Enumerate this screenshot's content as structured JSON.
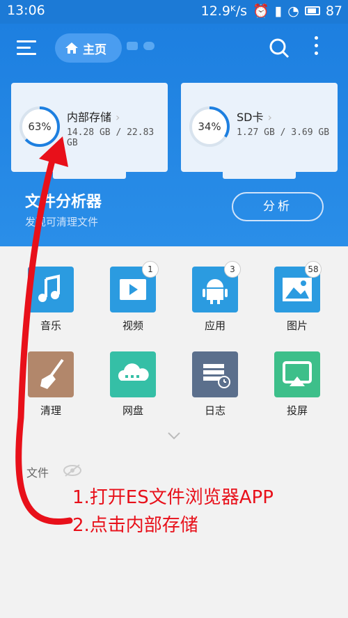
{
  "status_bar": {
    "time": "13:06",
    "speed": "12.9ᴷ/s",
    "battery": "87"
  },
  "header": {
    "home_label": "主页"
  },
  "storage": [
    {
      "name": "内部存储",
      "percent_label": "63%",
      "used_fraction": 0.63,
      "size": "14.28 GB / 22.83 GB"
    },
    {
      "name": "SD卡",
      "percent_label": "34%",
      "used_fraction": 0.34,
      "size": "1.27 GB / 3.69 GB"
    }
  ],
  "analyzer": {
    "title": "文件分析器",
    "subtitle": "发现可清理文件",
    "button": "分析"
  },
  "categories": [
    {
      "label": "音乐",
      "badge": ""
    },
    {
      "label": "视频",
      "badge": "1"
    },
    {
      "label": "应用",
      "badge": "3"
    },
    {
      "label": "图片",
      "badge": "58"
    },
    {
      "label": "清理",
      "badge": ""
    },
    {
      "label": "网盘",
      "badge": ""
    },
    {
      "label": "日志",
      "badge": ""
    },
    {
      "label": "投屏",
      "badge": ""
    }
  ],
  "files": {
    "label": "文件"
  },
  "annotations": {
    "line1": "1.打开ES文件浏览器APP",
    "line2": "2.点击内部存储"
  },
  "colors": {
    "header": "#1d7fe0",
    "accent_ring": "#1d7fe0",
    "annotation": "#e8101a"
  }
}
